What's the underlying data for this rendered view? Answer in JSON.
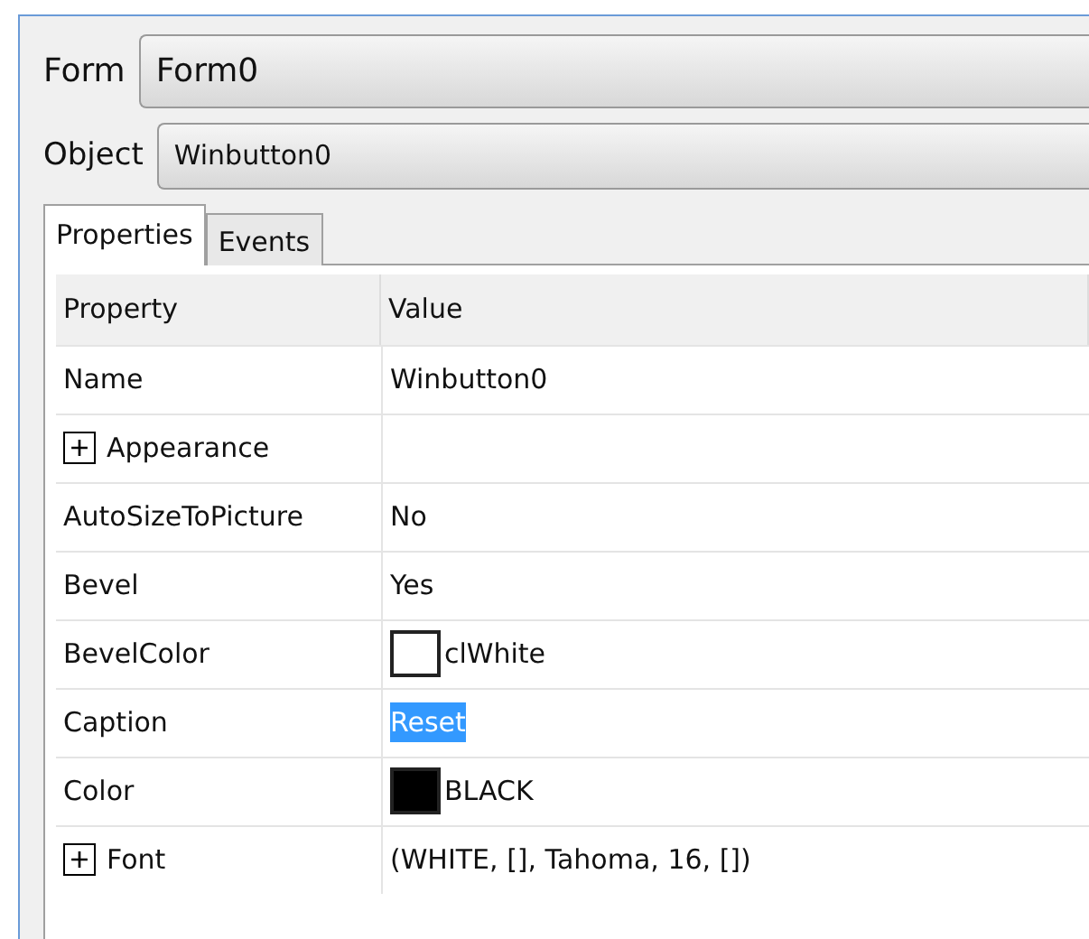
{
  "form": {
    "label": "Form",
    "value": "Form0"
  },
  "object": {
    "label": "Object",
    "value": "Winbutton0"
  },
  "tabs": [
    {
      "label": "Properties",
      "selected": true
    },
    {
      "label": "Events",
      "selected": false
    }
  ],
  "table": {
    "columns": [
      "Property",
      "Value"
    ],
    "rows": [
      {
        "kind": "text",
        "property": "Name",
        "value": "Winbutton0",
        "selected": false
      },
      {
        "kind": "group",
        "property": "Appearance",
        "expanded": false,
        "selected": false
      },
      {
        "kind": "text",
        "property": "AutoSizeToPicture",
        "value": "No",
        "selected": false
      },
      {
        "kind": "text",
        "property": "Bevel",
        "value": "Yes",
        "selected": false
      },
      {
        "kind": "color",
        "property": "BevelColor",
        "value": "clWhite",
        "color": "#ffffff",
        "selected": false
      },
      {
        "kind": "text",
        "property": "Caption",
        "value": "Reset",
        "selected": true
      },
      {
        "kind": "color",
        "property": "Color",
        "value": "BLACK",
        "color": "#000000",
        "selected": false
      },
      {
        "kind": "group",
        "property": "Font",
        "value": "(WHITE, [], Tahoma, 16, [])",
        "expanded": false,
        "selected": false
      }
    ]
  }
}
